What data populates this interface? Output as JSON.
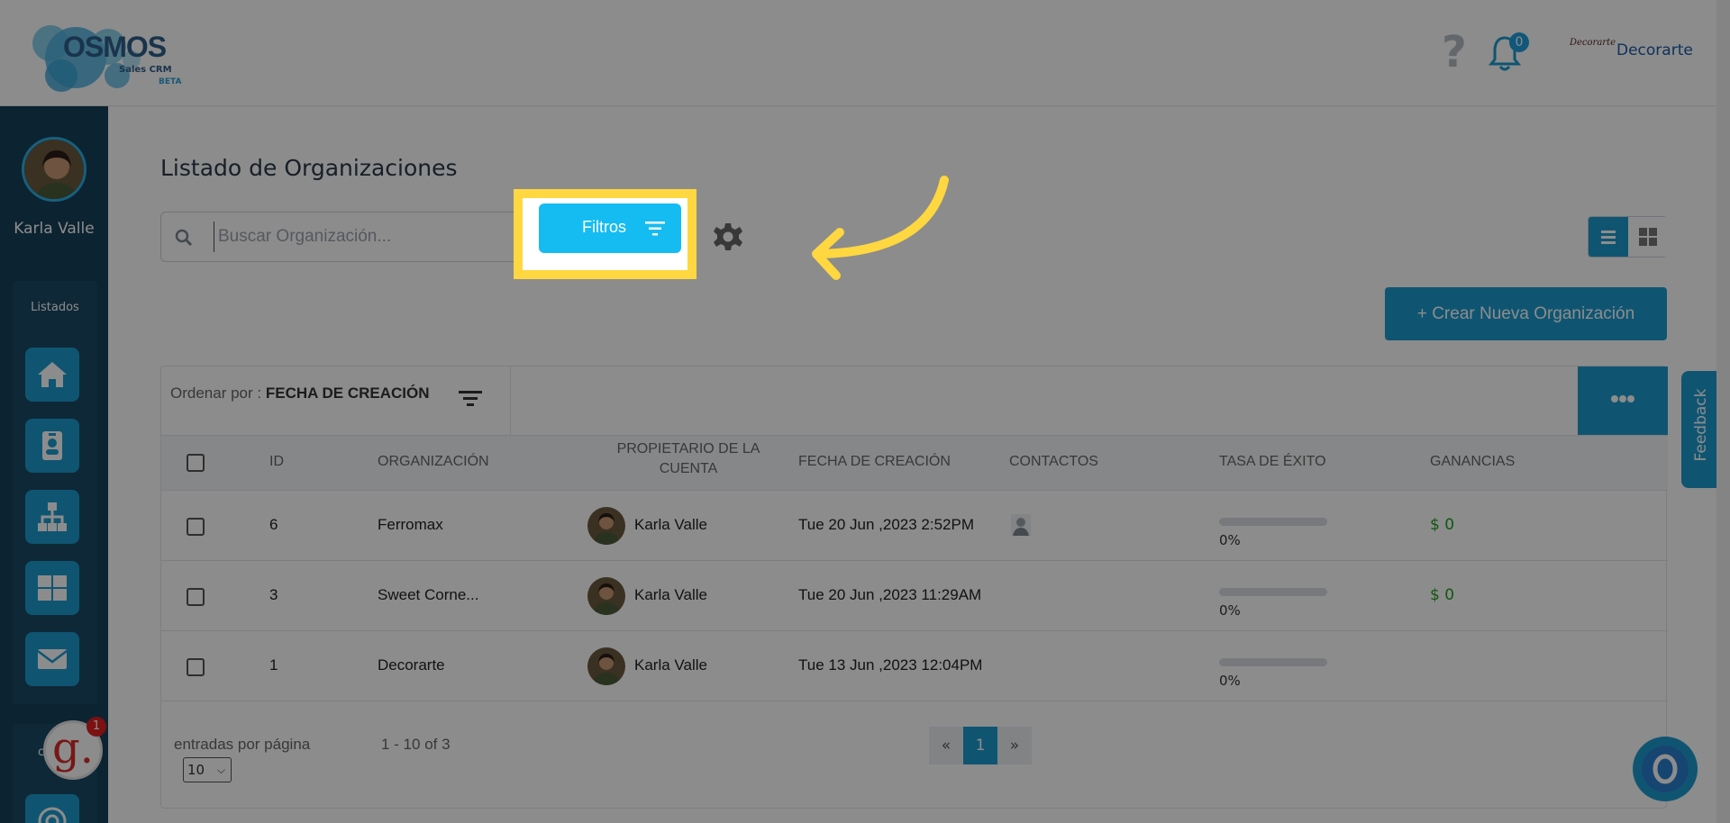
{
  "header": {
    "logo_text": "OSMOS",
    "logo_sub": "Sales CRM",
    "logo_tag": "BETA",
    "notifications_count": "0",
    "company_name": "Decorarte"
  },
  "sidebar": {
    "user_name": "Karla Valle",
    "section_label": "Listados",
    "items": [
      {
        "icon": "home-icon"
      },
      {
        "icon": "contact-card-icon"
      },
      {
        "icon": "org-chart-icon"
      },
      {
        "icon": "grid-icon"
      },
      {
        "icon": "mail-icon"
      }
    ],
    "second_section_initial": "c",
    "widget_letter": "g.",
    "widget_badge": "1"
  },
  "main": {
    "title": "Listado de Organizaciones",
    "search_placeholder": "Buscar Organización...",
    "filters_label": "Filtros",
    "create_label": "+ Crear Nueva Organización",
    "sort_prefix": "Ordenar por :",
    "sort_value": "FECHA DE CREACIÓN",
    "columns": {
      "id": "ID",
      "org": "ORGANIZACIÓN",
      "owner_1": "PROPIETARIO DE LA",
      "owner_2": "CUENTA",
      "date": "FECHA DE CREACIÓN",
      "contacts": "CONTACTOS",
      "rate": "TASA DE ÉXITO",
      "earnings": "GANANCIAS"
    },
    "rows": [
      {
        "id": "6",
        "org": "Ferromax",
        "owner": "Karla Valle",
        "date": "Tue 20 Jun ,2023 2:52PM",
        "has_contact": true,
        "rate": "0%",
        "rate_value": 0,
        "earnings": "$ 0"
      },
      {
        "id": "3",
        "org": "Sweet Corne...",
        "owner": "Karla Valle",
        "date": "Tue 20 Jun ,2023 11:29AM",
        "has_contact": false,
        "rate": "0%",
        "rate_value": 0,
        "earnings": "$ 0"
      },
      {
        "id": "1",
        "org": "Decorarte",
        "owner": "Karla Valle",
        "date": "Tue 13 Jun ,2023 12:04PM",
        "has_contact": false,
        "rate": "0%",
        "rate_value": 0,
        "earnings": ""
      }
    ],
    "footer": {
      "per_page_label": "entradas por página",
      "per_page_value": "10",
      "range": "1 - 10 of 3",
      "prev": "«",
      "page": "1",
      "next": "»"
    }
  },
  "feedback_label": "Feedback",
  "colors": {
    "primary": "#1d9cd0",
    "highlight": "#ffd740",
    "sidebar": "#16405a",
    "filter_button": "#14bcf2"
  }
}
